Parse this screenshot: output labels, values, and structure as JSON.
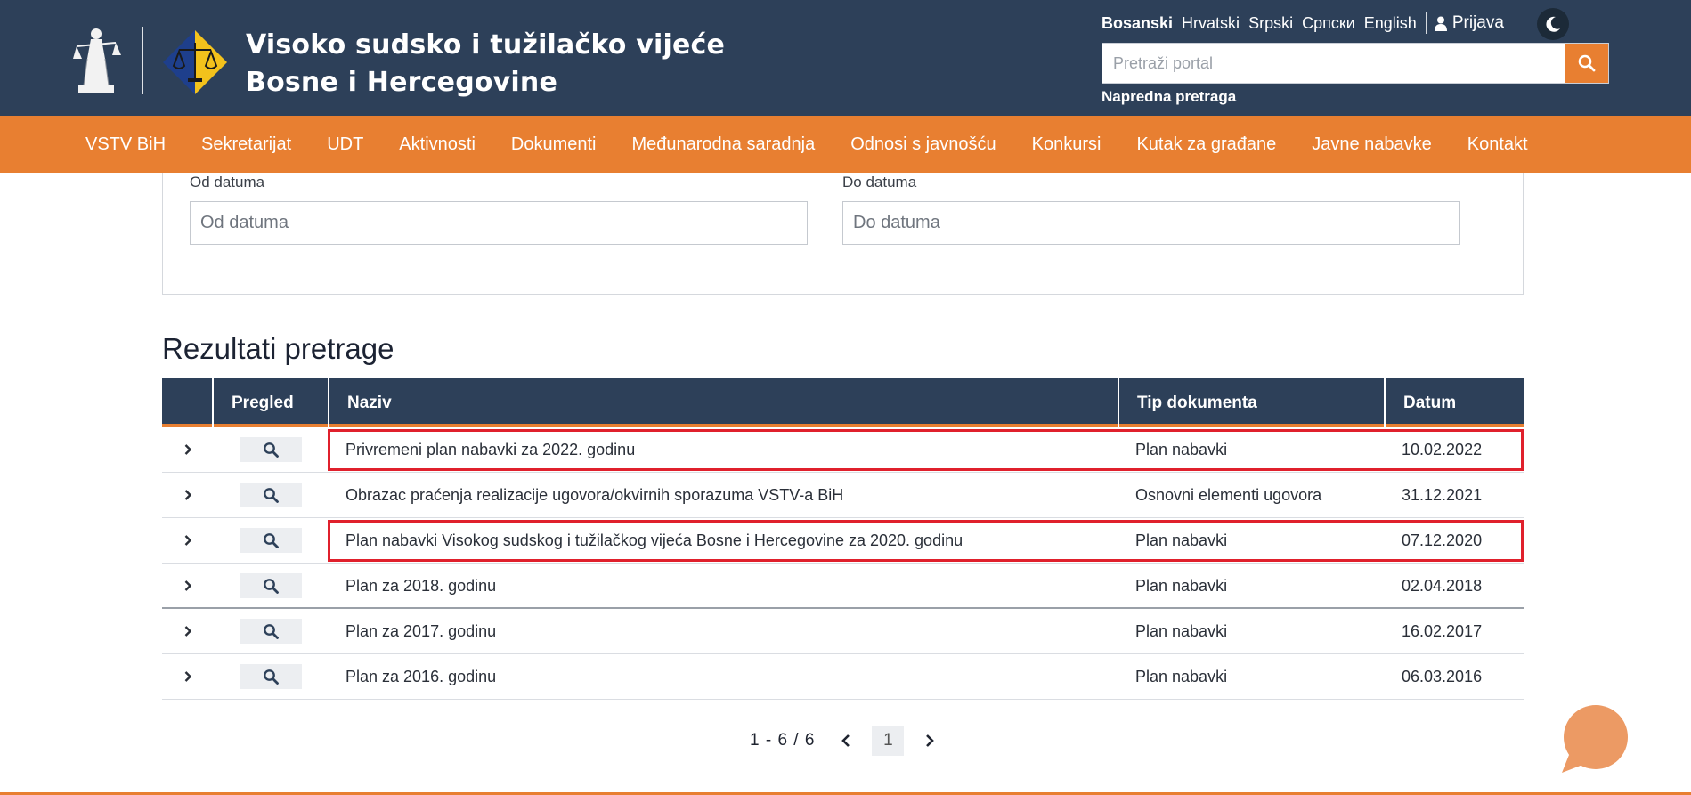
{
  "header": {
    "title_line1": "Visoko sudsko i tužilačko vijeće",
    "title_line2": "Bosne i Hercegovine",
    "languages": [
      "Bosanski",
      "Hrvatski",
      "Srpski",
      "Српски",
      "English"
    ],
    "active_language": "Bosanski",
    "login_label": "Prijava",
    "search_placeholder": "Pretraži portal",
    "advanced_search_label": "Napredna pretraga"
  },
  "nav": {
    "items": [
      "VSTV BiH",
      "Sekretarijat",
      "UDT",
      "Aktivnosti",
      "Dokumenti",
      "Međunarodna saradnja",
      "Odnosi s javnošću",
      "Konkursi",
      "Kutak za građane",
      "Javne nabavke",
      "Kontakt"
    ]
  },
  "filters": {
    "from_label": "Od datuma",
    "from_placeholder": "Od datuma",
    "to_label": "Do datuma",
    "to_placeholder": "Do datuma"
  },
  "results": {
    "title": "Rezultati pretrage",
    "columns": [
      "",
      "Pregled",
      "Naziv",
      "Tip dokumenta",
      "Datum"
    ],
    "rows": [
      {
        "name": "Privremeni plan nabavki za 2022. godinu",
        "type": "Plan nabavki",
        "date": "10.02.2022",
        "highlighted": true
      },
      {
        "name": "Obrazac praćenja realizacije ugovora/okvirnih sporazuma VSTV-a BiH",
        "type": "Osnovni elementi ugovora",
        "date": "31.12.2021",
        "highlighted": false
      },
      {
        "name": "Plan nabavki Visokog sudskog i tužilačkog vijeća Bosne i Hercegovine za 2020. godinu",
        "type": "Plan nabavki",
        "date": "07.12.2020",
        "highlighted": true
      },
      {
        "name": "Plan za 2018. godinu",
        "type": "Plan nabavki",
        "date": "02.04.2018",
        "highlighted": false
      },
      {
        "name": "Plan za 2017. godinu",
        "type": "Plan nabavki",
        "date": "16.02.2017",
        "highlighted": false
      },
      {
        "name": "Plan za 2016. godinu",
        "type": "Plan nabavki",
        "date": "06.03.2016",
        "highlighted": false
      }
    ]
  },
  "pagination": {
    "count_label": "1 - 6 / 6",
    "current_page": "1"
  },
  "colors": {
    "header_bg": "#2d4059",
    "accent": "#e87f31",
    "highlight": "#e0202c"
  },
  "icons": {
    "search": "search-icon",
    "user": "user-icon",
    "theme": "moon-icon",
    "expand": "chevron-right-icon",
    "preview": "magnifier-icon",
    "prev": "chevron-left-icon",
    "next": "chevron-right-icon",
    "chat": "chat-bubble-icon"
  }
}
